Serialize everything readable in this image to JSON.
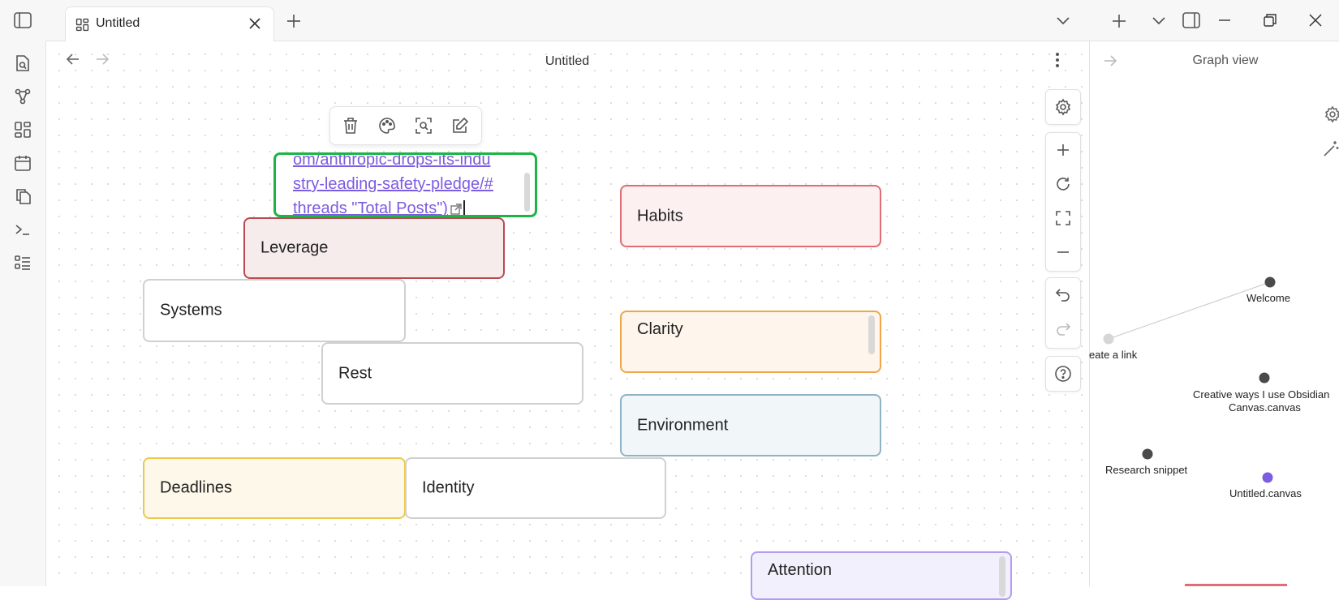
{
  "tab": {
    "title": "Untitled"
  },
  "view": {
    "title": "Untitled"
  },
  "graph": {
    "title": "Graph view",
    "nodes": [
      {
        "label": "Welcome"
      },
      {
        "label": "eate a link"
      },
      {
        "label": "Creative ways I use Obsidian"
      },
      {
        "label": "Canvas.canvas"
      },
      {
        "label": "Research snippet"
      },
      {
        "label": "Untitled.canvas"
      }
    ]
  },
  "cards": {
    "editing": {
      "line1": "om/anthropic-drops-its-indu",
      "line2": "stry-leading-safety-pledge/#",
      "line3": "threads \"Total Posts\")"
    },
    "leverage": "Leverage",
    "habits": "Habits",
    "systems": "Systems",
    "clarity": "Clarity",
    "rest": "Rest",
    "environment": "Environment",
    "deadlines": "Deadlines",
    "identity": "Identity",
    "attention": "Attention"
  },
  "colors": {
    "red": "#e06c75",
    "red_bg": "#fdf0f1",
    "darkred": "#b84a52",
    "darkred_bg": "#f7ecec",
    "orange": "#f0a54a",
    "orange_bg": "#fef5ec",
    "blue": "#8fb2c7",
    "blue_bg": "#f1f6f9",
    "yellow": "#ebc94f",
    "yellow_bg": "#fdf8e9",
    "purple": "#b39cf0",
    "purple_bg": "#f3f0fd",
    "green": "#1db446",
    "accent": "#7c5ce0"
  }
}
